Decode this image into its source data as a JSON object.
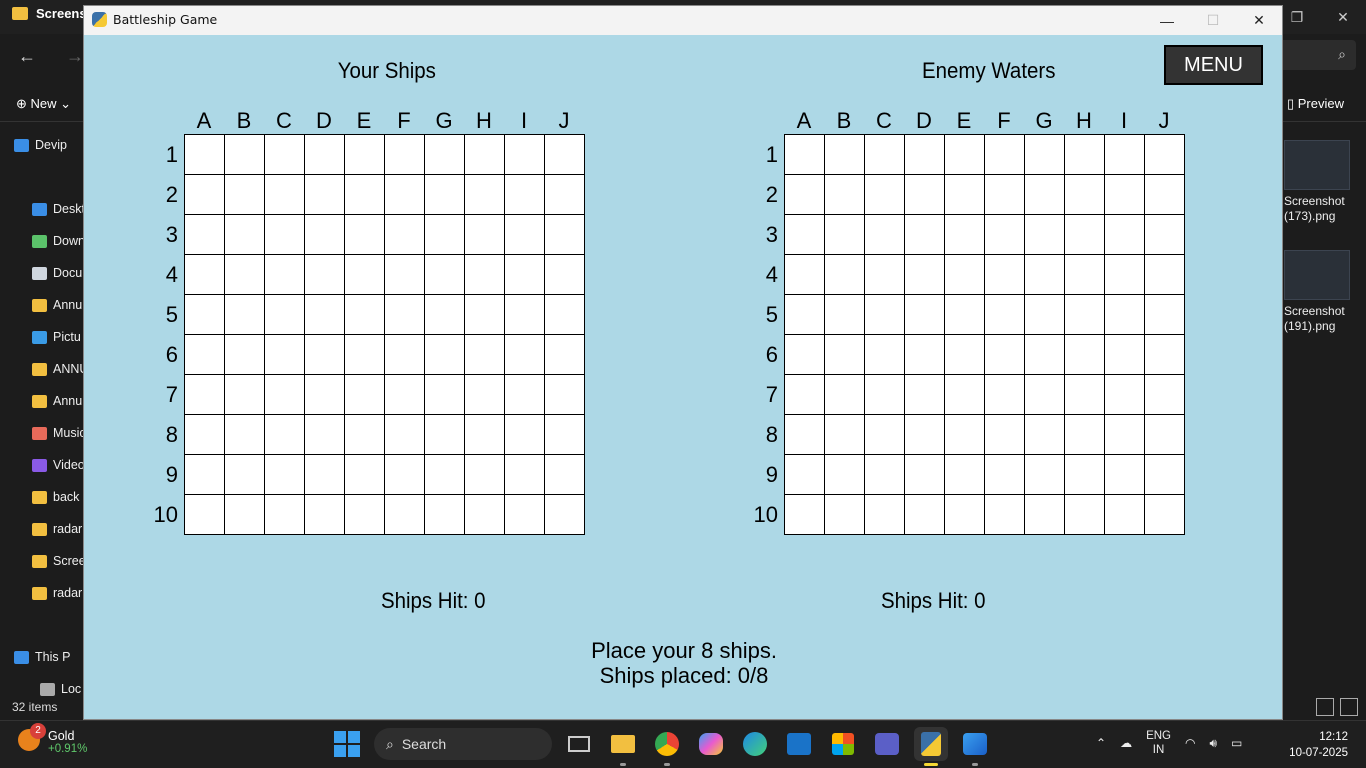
{
  "explorer": {
    "tab_title": "Screens",
    "new_label": "New",
    "preview_label": "Preview",
    "status": "32 items",
    "sidebar": [
      {
        "label": "Devip",
        "color": "#3a8ee6"
      },
      {
        "label": "Deskt",
        "color": "#3a8ee6"
      },
      {
        "label": "Down",
        "color": "#5bc26a"
      },
      {
        "label": "Docu",
        "color": "#cfd6de"
      },
      {
        "label": "Annu",
        "color": "#f2bf40"
      },
      {
        "label": "Pictu",
        "color": "#3a9be6"
      },
      {
        "label": "ANNU",
        "color": "#f2bf40"
      },
      {
        "label": "Annu",
        "color": "#f2bf40"
      },
      {
        "label": "Music",
        "color": "#e86a5a"
      },
      {
        "label": "Video",
        "color": "#8a5ae6"
      },
      {
        "label": "back",
        "color": "#f2bf40"
      },
      {
        "label": "radar",
        "color": "#f2bf40"
      },
      {
        "label": "Scree",
        "color": "#f2bf40"
      },
      {
        "label": "radar",
        "color": "#f2bf40"
      },
      {
        "label": "This P",
        "color": "#3a8ee6"
      },
      {
        "label": "Loc",
        "color": "#aaaaaa"
      }
    ],
    "files": [
      {
        "label": "Screenshot (173).png"
      },
      {
        "label": "Screenshot (191).png"
      }
    ]
  },
  "window": {
    "title": "Battleship Game",
    "menu_label": "MENU",
    "left_title": "Your Ships",
    "right_title": "Enemy Waters",
    "columns": [
      "A",
      "B",
      "C",
      "D",
      "E",
      "F",
      "G",
      "H",
      "I",
      "J"
    ],
    "rows": [
      "1",
      "2",
      "3",
      "4",
      "5",
      "6",
      "7",
      "8",
      "9",
      "10"
    ],
    "left_stat": "Ships Hit: 0",
    "right_stat": "Ships Hit: 0",
    "status_line1": "Place your 8 ships.",
    "status_line2": "Ships placed: 0/8"
  },
  "taskbar": {
    "weather_label": "Gold",
    "weather_change": "+0.91%",
    "weather_badge": "2",
    "search_label": "Search",
    "lang1": "ENG",
    "lang2": "IN",
    "time": "12:12",
    "date": "10-07-2025"
  },
  "colors": {
    "game_bg": "#add8e6",
    "cell": "#ffffff",
    "menu_bg": "#333333"
  }
}
